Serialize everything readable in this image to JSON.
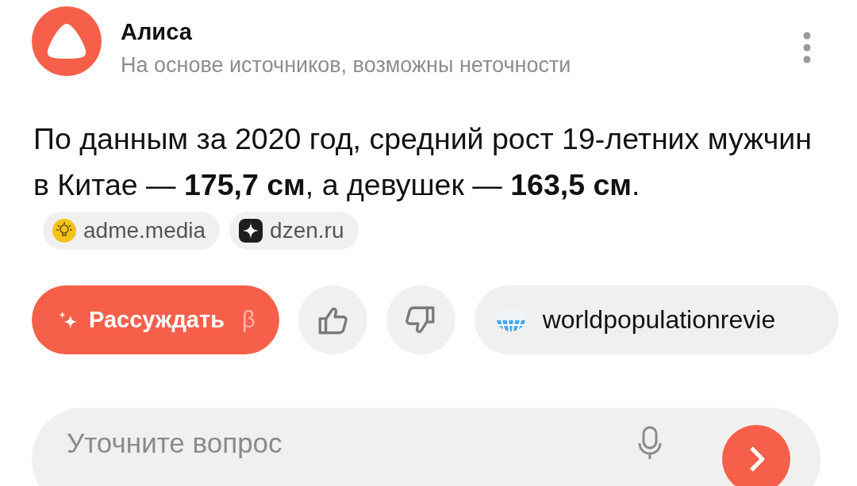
{
  "header": {
    "title": "Алиса",
    "subtitle": "На основе источников, возможны неточности"
  },
  "answer": {
    "text": "По данным за 2020 год, средний рост 19-летних мужчин в Китае — **175,7 см**, а девушек — **163,5 см**.",
    "sources": [
      {
        "label": "adme.media",
        "kind": "bulb"
      },
      {
        "label": "dzen.ru",
        "kind": "star"
      }
    ]
  },
  "actions": {
    "reason": {
      "label": "Рассуждать",
      "badge": "β"
    },
    "source_link": {
      "label": "worldpopulationrevie"
    }
  },
  "input": {
    "placeholder": "Уточните вопрос"
  }
}
